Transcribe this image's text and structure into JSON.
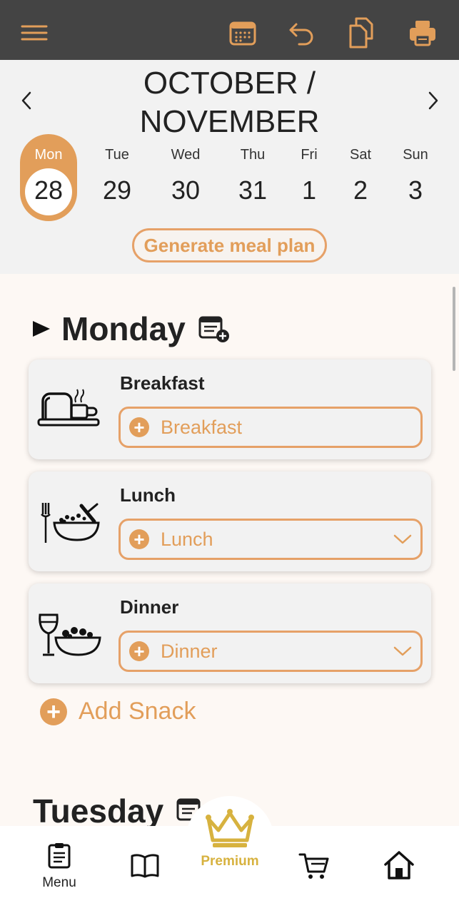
{
  "topbar": {
    "icons": [
      "hamburger-menu-icon",
      "calendar-icon",
      "undo-icon",
      "copy-icon",
      "print-icon"
    ]
  },
  "calendar": {
    "month_label": "OCTOBER / NOVEMBER",
    "month_line1": "OCTOBER /",
    "month_line2": "NOVEMBER",
    "days": [
      {
        "name": "Mon",
        "date": "28"
      },
      {
        "name": "Tue",
        "date": "29"
      },
      {
        "name": "Wed",
        "date": "30"
      },
      {
        "name": "Thu",
        "date": "31"
      },
      {
        "name": "Fri",
        "date": "1"
      },
      {
        "name": "Sat",
        "date": "2"
      },
      {
        "name": "Sun",
        "date": "3"
      }
    ],
    "generate_label": "Generate meal plan"
  },
  "plan": {
    "monday": {
      "title": "Monday",
      "meals": [
        {
          "label": "Breakfast",
          "placeholder": "Breakfast"
        },
        {
          "label": "Lunch",
          "placeholder": "Lunch"
        },
        {
          "label": "Dinner",
          "placeholder": "Dinner"
        }
      ],
      "add_snack": "Add Snack"
    },
    "tuesday": {
      "title": "Tuesday"
    }
  },
  "bottom_nav": {
    "menu_label": "Menu",
    "premium_label": "Premium"
  },
  "colors": {
    "accent": "#e29e5a",
    "topbar": "#444444",
    "premium_gold": "#d7b23f"
  }
}
